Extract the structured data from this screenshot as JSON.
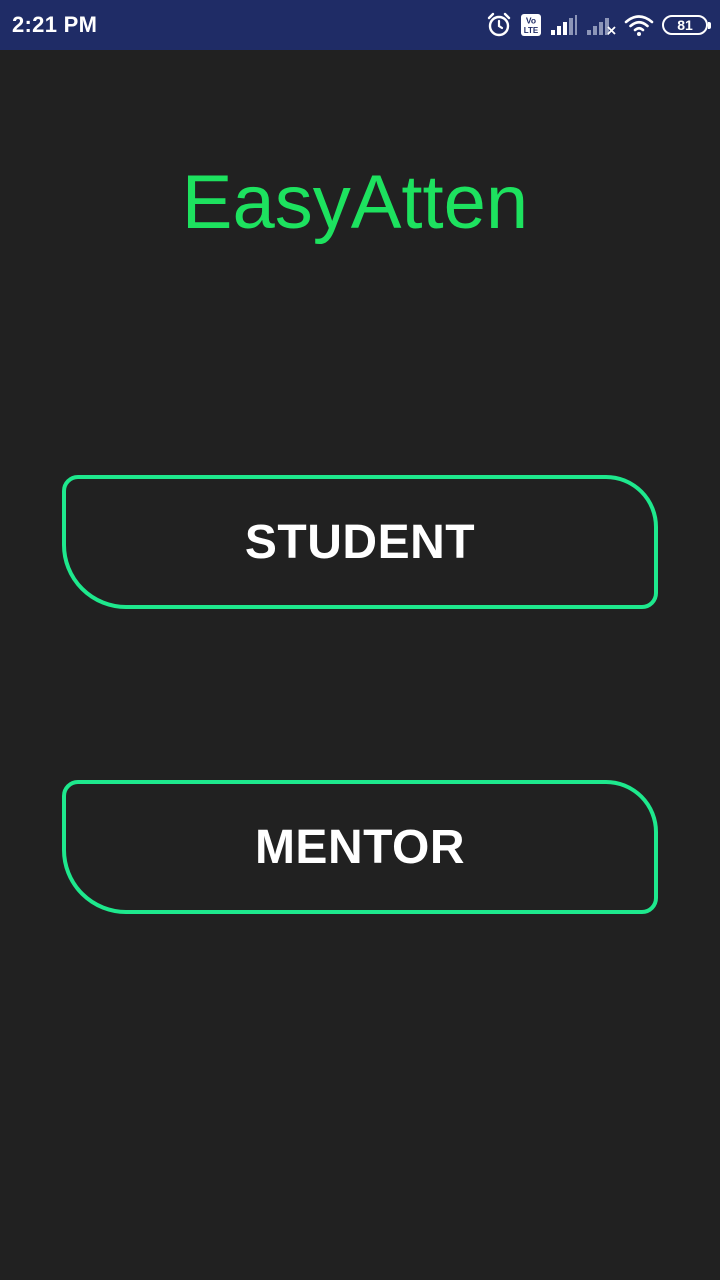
{
  "status_bar": {
    "time": "2:21 PM",
    "volte_label_top": "Vo",
    "volte_label_bottom": "LTE",
    "battery_level": "81",
    "icons": [
      "alarm-icon",
      "volte-icon",
      "signal-icon",
      "signal-no-service-icon",
      "wifi-icon",
      "battery-icon"
    ]
  },
  "app": {
    "title": "EasyAtten"
  },
  "buttons": {
    "student_label": "STUDENT",
    "mentor_label": "MENTOR"
  },
  "colors": {
    "status_bar_bg": "#1f2c66",
    "background": "#212121",
    "title": "#1de25f",
    "button_border": "#1ee88d",
    "button_text": "#ffffff"
  }
}
